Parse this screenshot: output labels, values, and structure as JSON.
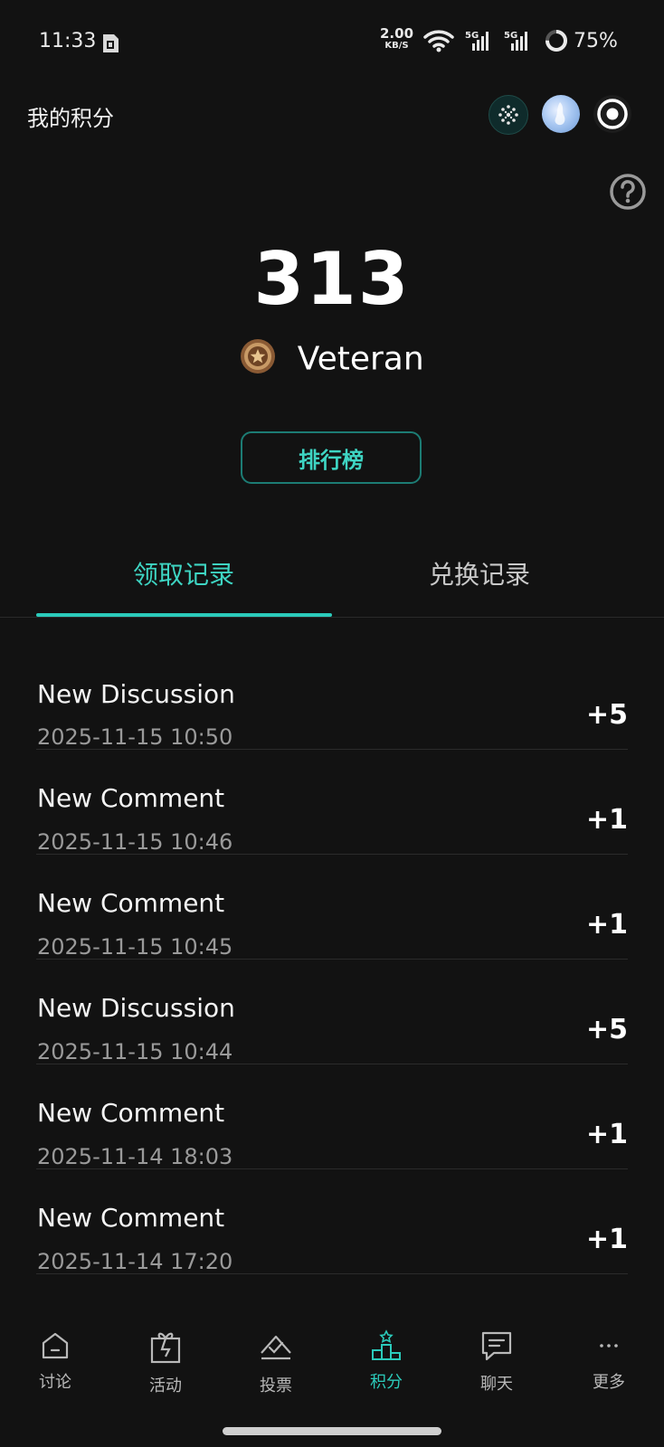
{
  "status_bar": {
    "time": "11:33",
    "net_speed": "2.00",
    "net_speed_unit": "KB/S",
    "battery_percent": "75%",
    "signal_1": "5G",
    "signal_2": "5G"
  },
  "header": {
    "title": "我的积分"
  },
  "score": {
    "value": "313",
    "rank_label": "Veteran"
  },
  "leaderboard_button": "排行榜",
  "tabs": [
    {
      "label": "领取记录",
      "active": true
    },
    {
      "label": "兑换记录",
      "active": false
    }
  ],
  "records": [
    {
      "title": "New Discussion",
      "date": "2025-11-15 10:50",
      "points": "+5"
    },
    {
      "title": "New Comment",
      "date": "2025-11-15 10:46",
      "points": "+1"
    },
    {
      "title": "New Comment",
      "date": "2025-11-15 10:45",
      "points": "+1"
    },
    {
      "title": "New Discussion",
      "date": "2025-11-15 10:44",
      "points": "+5"
    },
    {
      "title": "New Comment",
      "date": "2025-11-14 18:03",
      "points": "+1"
    },
    {
      "title": "New Comment",
      "date": "2025-11-14 17:20",
      "points": "+1"
    }
  ],
  "nav": [
    {
      "label": "讨论",
      "icon": "home-icon"
    },
    {
      "label": "活动",
      "icon": "gift-icon"
    },
    {
      "label": "投票",
      "icon": "vote-icon"
    },
    {
      "label": "积分",
      "icon": "podium-icon",
      "active": true
    },
    {
      "label": "聊天",
      "icon": "chat-icon"
    },
    {
      "label": "更多",
      "icon": "more-icon"
    }
  ],
  "colors": {
    "accent": "#2bcbbb",
    "background": "#121212"
  }
}
